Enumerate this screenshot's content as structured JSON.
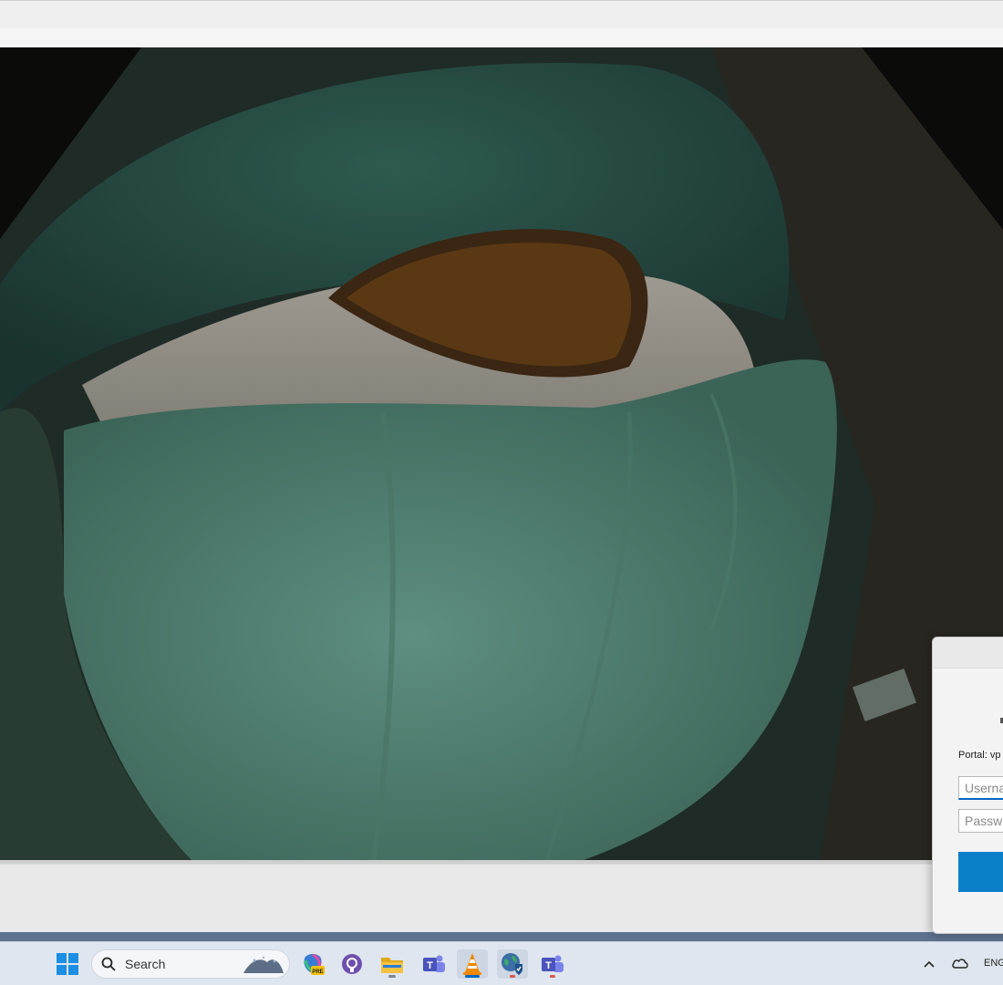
{
  "dialog": {
    "portal_label": "Portal: vp",
    "username_placeholder": "Userna",
    "password_placeholder": "Passwo"
  },
  "taskbar": {
    "search_label": "Search",
    "language": "ENG",
    "apps": [
      {
        "name": "start-button",
        "icon": "windows-logo-icon"
      },
      {
        "name": "copilot",
        "icon": "copilot-pre-icon"
      },
      {
        "name": "github-desktop",
        "icon": "github-icon"
      },
      {
        "name": "file-explorer",
        "icon": "folder-icon"
      },
      {
        "name": "teams-classic",
        "icon": "teams-icon"
      },
      {
        "name": "vlc",
        "icon": "vlc-cone-icon"
      },
      {
        "name": "vpn-browser",
        "icon": "globe-shield-icon"
      },
      {
        "name": "teams",
        "icon": "teams-icon"
      }
    ]
  },
  "colors": {
    "accent": "#0a7fc9",
    "taskbar_bg": "#dfe6ef",
    "active_indicator": "#0067c0",
    "notify_indicator": "#d9534f"
  }
}
